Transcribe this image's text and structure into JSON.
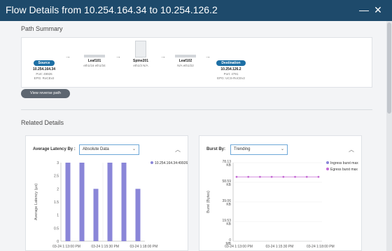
{
  "window": {
    "title": "Flow Details from 10.254.164.34 to 10.254.126.2",
    "minimize_glyph": "—",
    "close_glyph": "✕"
  },
  "path_summary": {
    "heading": "Path Summary",
    "nodes": [
      {
        "badge": "Source",
        "name": "10.254.164.34",
        "line1": "Port: 49926",
        "line2": "EPG: RoCEv2"
      },
      {
        "name": "Leaf101",
        "line1": "eth1/16 eth1/34"
      },
      {
        "name": "Spine201",
        "line1": "eth1/3 N/A"
      },
      {
        "name": "Leaf102",
        "line1": "N/A eth1/22"
      },
      {
        "badge": "Destination",
        "name": "10.254.126.2",
        "line1": "Port: 4791",
        "line2": "EPG: UCS-RoCEv2"
      }
    ],
    "arrow": "→",
    "reverse_button": "View reverse path"
  },
  "related": {
    "heading": "Related Details"
  },
  "latency_card": {
    "label": "Average Latency By :",
    "select_value": "Absolute Data",
    "collapse_glyph": "︿"
  },
  "burst_card": {
    "label": "Burst By:",
    "select_value": "Trending",
    "collapse_glyph": "︿"
  },
  "colors": {
    "titlebar": "#1e4a6b",
    "bars": "#8a86d8",
    "burst_line": "#c56bd4",
    "ingress": "#8a86d8",
    "egress": "#c56bd4"
  },
  "chart_data": [
    {
      "type": "bar",
      "ylabel": "Average Latency (µs)",
      "xticks": [
        "03-24 1:13:00 PM",
        "03-24 1:15:30 PM",
        "03-24 1:18:00 PM"
      ],
      "yticks": [
        "0",
        "0.5",
        "1",
        "1.5",
        "2",
        "2.5",
        "3"
      ],
      "ylim": [
        0,
        3
      ],
      "series": [
        {
          "name": "10.254.164.34:49926",
          "values": [
            3,
            3,
            2,
            3,
            3,
            2
          ]
        }
      ],
      "legend": "top-right"
    },
    {
      "type": "line",
      "ylabel": "Burst (Bytes)",
      "xticks": [
        "03-24 1:13:00 PM",
        "03-24 1:15:30 PM",
        "03-24 1:18:00 PM"
      ],
      "yticks": [
        "0 MB",
        "19.53 KB",
        "39.06 KB",
        "58.59 KB",
        "78.13 KB"
      ],
      "ylim": [
        0,
        78.13
      ],
      "series": [
        {
          "name": "Ingress burst max",
          "values": []
        },
        {
          "name": "Egress burst max",
          "values": [
            64,
            64,
            64,
            64,
            64,
            64,
            64,
            64
          ]
        }
      ],
      "legend": "top-right"
    }
  ]
}
